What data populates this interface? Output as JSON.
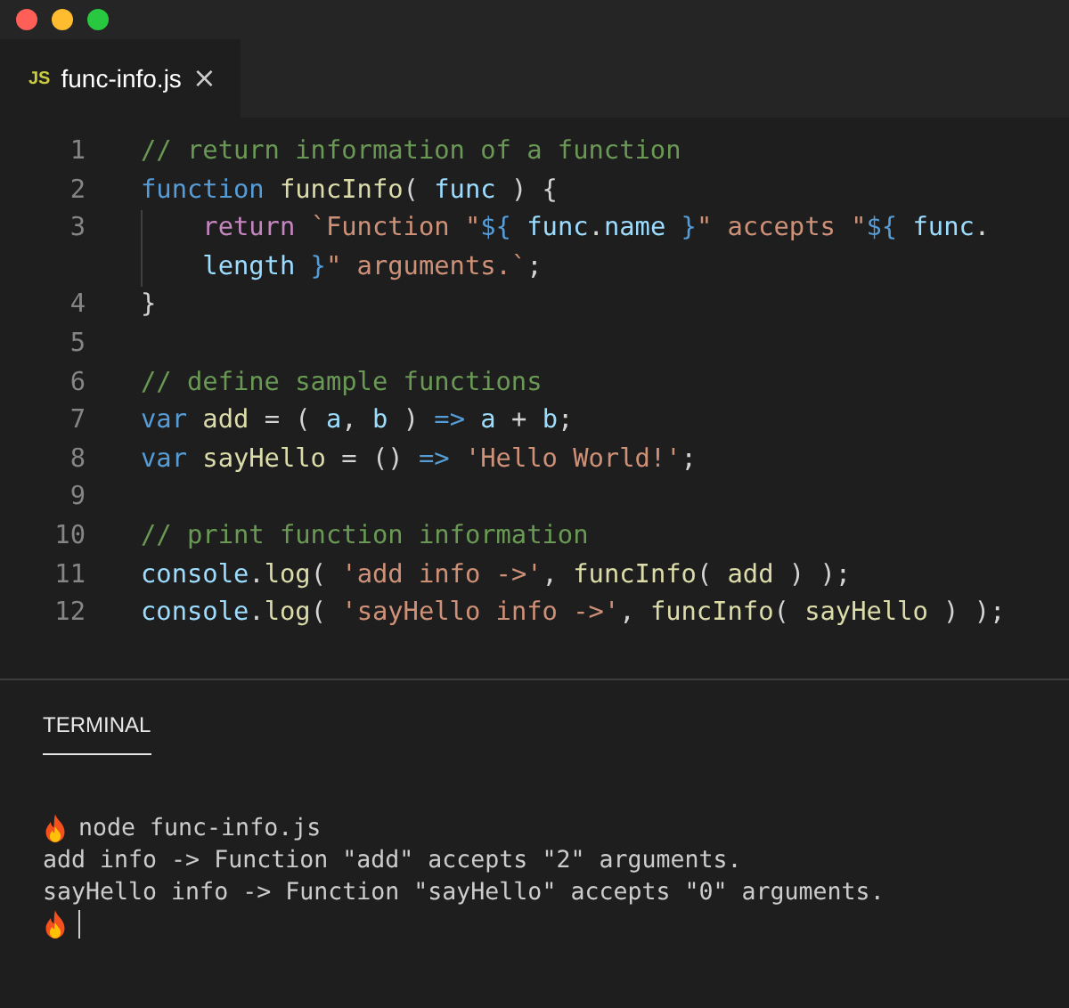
{
  "window": {
    "traffic_lights": [
      {
        "color": "#ff5f57"
      },
      {
        "color": "#febc2e"
      },
      {
        "color": "#28c840"
      }
    ]
  },
  "tabs": [
    {
      "icon": "JS",
      "label": "func-info.js",
      "close": "×",
      "selected": true
    }
  ],
  "editor": {
    "lines": [
      {
        "number": "1",
        "rows": [
          [
            {
              "kind": "comment",
              "text": "// return information of a function"
            }
          ]
        ]
      },
      {
        "number": "2",
        "rows": [
          [
            {
              "kind": "keyword",
              "text": "function "
            },
            {
              "kind": "func",
              "text": "funcInfo"
            },
            {
              "kind": "plain",
              "text": "( "
            },
            {
              "kind": "var",
              "text": "func"
            },
            {
              "kind": "plain",
              "text": " ) {"
            }
          ]
        ]
      },
      {
        "number": "3",
        "indent_guide": true,
        "rows": [
          [
            {
              "kind": "plain",
              "text": "    "
            },
            {
              "kind": "control",
              "text": "return "
            },
            {
              "kind": "string",
              "text": "`Function \""
            },
            {
              "kind": "keyword",
              "text": "${ "
            },
            {
              "kind": "var",
              "text": "func"
            },
            {
              "kind": "plain",
              "text": "."
            },
            {
              "kind": "var",
              "text": "name"
            },
            {
              "kind": "keyword",
              "text": " }"
            },
            {
              "kind": "string",
              "text": "\" accepts \""
            },
            {
              "kind": "keyword",
              "text": "${ "
            },
            {
              "kind": "var",
              "text": "func"
            },
            {
              "kind": "plain",
              "text": "."
            }
          ],
          [
            {
              "kind": "plain",
              "text": "    "
            },
            {
              "kind": "var",
              "text": "length"
            },
            {
              "kind": "keyword",
              "text": " }"
            },
            {
              "kind": "string",
              "text": "\" arguments.`"
            },
            {
              "kind": "plain",
              "text": ";"
            }
          ]
        ]
      },
      {
        "number": "4",
        "rows": [
          [
            {
              "kind": "plain",
              "text": "}"
            }
          ]
        ]
      },
      {
        "number": "5",
        "rows": [
          []
        ]
      },
      {
        "number": "6",
        "rows": [
          [
            {
              "kind": "comment",
              "text": "// define sample functions"
            }
          ]
        ]
      },
      {
        "number": "7",
        "rows": [
          [
            {
              "kind": "keyword",
              "text": "var "
            },
            {
              "kind": "func",
              "text": "add"
            },
            {
              "kind": "plain",
              "text": " = ( "
            },
            {
              "kind": "var",
              "text": "a"
            },
            {
              "kind": "plain",
              "text": ", "
            },
            {
              "kind": "var",
              "text": "b"
            },
            {
              "kind": "plain",
              "text": " ) "
            },
            {
              "kind": "keyword",
              "text": "=>"
            },
            {
              "kind": "plain",
              "text": " "
            },
            {
              "kind": "var",
              "text": "a"
            },
            {
              "kind": "plain",
              "text": " + "
            },
            {
              "kind": "var",
              "text": "b"
            },
            {
              "kind": "plain",
              "text": ";"
            }
          ]
        ]
      },
      {
        "number": "8",
        "rows": [
          [
            {
              "kind": "keyword",
              "text": "var "
            },
            {
              "kind": "func",
              "text": "sayHello"
            },
            {
              "kind": "plain",
              "text": " = () "
            },
            {
              "kind": "keyword",
              "text": "=>"
            },
            {
              "kind": "plain",
              "text": " "
            },
            {
              "kind": "string",
              "text": "'Hello World!'"
            },
            {
              "kind": "plain",
              "text": ";"
            }
          ]
        ]
      },
      {
        "number": "9",
        "rows": [
          []
        ]
      },
      {
        "number": "10",
        "rows": [
          [
            {
              "kind": "comment",
              "text": "// print function information"
            }
          ]
        ]
      },
      {
        "number": "11",
        "rows": [
          [
            {
              "kind": "var",
              "text": "console"
            },
            {
              "kind": "plain",
              "text": "."
            },
            {
              "kind": "func",
              "text": "log"
            },
            {
              "kind": "plain",
              "text": "( "
            },
            {
              "kind": "string",
              "text": "'add info ->'"
            },
            {
              "kind": "plain",
              "text": ", "
            },
            {
              "kind": "func",
              "text": "funcInfo"
            },
            {
              "kind": "plain",
              "text": "( "
            },
            {
              "kind": "func",
              "text": "add"
            },
            {
              "kind": "plain",
              "text": " ) );"
            }
          ]
        ]
      },
      {
        "number": "12",
        "rows": [
          [
            {
              "kind": "var",
              "text": "console"
            },
            {
              "kind": "plain",
              "text": "."
            },
            {
              "kind": "func",
              "text": "log"
            },
            {
              "kind": "plain",
              "text": "( "
            },
            {
              "kind": "string",
              "text": "'sayHello info ->'"
            },
            {
              "kind": "plain",
              "text": ", "
            },
            {
              "kind": "func",
              "text": "funcInfo"
            },
            {
              "kind": "plain",
              "text": "( "
            },
            {
              "kind": "func",
              "text": "sayHello"
            },
            {
              "kind": "plain",
              "text": " ) );"
            }
          ]
        ]
      }
    ]
  },
  "panel": {
    "tabs": [
      {
        "label": "TERMINAL",
        "selected": true
      }
    ],
    "terminal": [
      {
        "kind": "prompt",
        "text": "node func-info.js"
      },
      {
        "kind": "output",
        "text": "add info -> Function \"add\" accepts \"2\" arguments."
      },
      {
        "kind": "output",
        "text": "sayHello info -> Function \"sayHello\" accepts \"0\" arguments."
      },
      {
        "kind": "cursor"
      }
    ]
  }
}
